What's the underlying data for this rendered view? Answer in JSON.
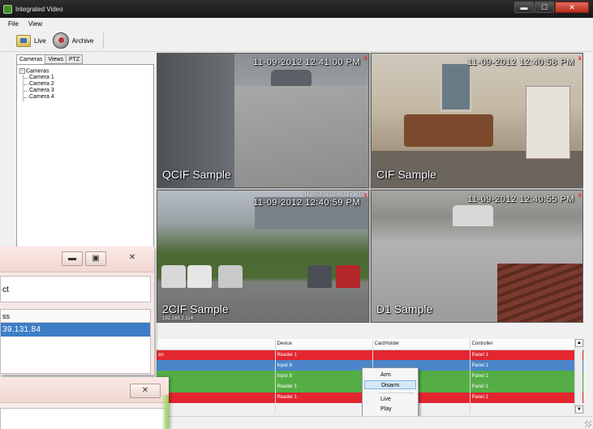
{
  "window": {
    "title": "Integrated Video",
    "caption_min": "▬",
    "caption_max": "☐",
    "caption_close": "✕"
  },
  "menu": {
    "items": [
      "File",
      "View"
    ]
  },
  "toolbar": {
    "live_label": "Live",
    "archive_label": "Archive"
  },
  "left_panel": {
    "tabs": [
      "Cameras",
      "Views",
      "PTZ"
    ],
    "tree": {
      "root": "Cameras",
      "toggle": "−",
      "children": [
        "Camera 1",
        "Camera 2",
        "Camera 3",
        "Camera 4"
      ]
    }
  },
  "video_tiles": [
    {
      "label": "QCIF Sample",
      "timestamp": "11-09-2012 12:41:00 PM",
      "close": "x"
    },
    {
      "label": "CIF Sample",
      "timestamp": "11-09-2012 12:40:58 PM",
      "close": "x"
    },
    {
      "label": "2CIF Sample",
      "timestamp": "11-09-2012 12:40:59 PM",
      "small_timestamp": "11-09-2012 02:48:13 PM Fr",
      "ip": "192.168.2.114",
      "close": "x"
    },
    {
      "label": "D1 Sample",
      "timestamp": "11-09-2012 12:40:55 PM",
      "close": "x"
    }
  ],
  "events_grid": {
    "columns": [
      "",
      "Device",
      "CardHolder",
      "Controller"
    ],
    "rows": [
      {
        "color": "red",
        "cells": [
          "en",
          "Reader 1",
          "",
          "Panel 1"
        ]
      },
      {
        "color": "blue",
        "cells": [
          "",
          "Input 8",
          "",
          "Panel 1"
        ]
      },
      {
        "color": "green",
        "cells": [
          "",
          "Input 8",
          "",
          "Panel 1"
        ]
      },
      {
        "color": "green",
        "cells": [
          "",
          "Reader 1",
          "",
          "Panel 1"
        ]
      },
      {
        "color": "red",
        "cells": [
          "",
          "Reader 1",
          "",
          "Panel 1"
        ]
      }
    ],
    "scroll_up": "▲",
    "scroll_down": "▼"
  },
  "context_menu": {
    "items": [
      "Arm",
      "Disarm",
      "Live",
      "Play"
    ],
    "highlighted": "Disarm"
  },
  "overlay_window_1": {
    "min_glyph": "▬",
    "max_glyph": "▣",
    "close_glyph": "✕",
    "field_text": "ct",
    "list_header": "ss",
    "list_row": "39.131.84"
  },
  "overlay_window_2": {
    "close_glyph": "✕"
  },
  "colors": {
    "row_red": "#e32630",
    "row_blue": "#4a86c9",
    "row_green": "#55ae45",
    "selection": "#3d7ec7"
  }
}
